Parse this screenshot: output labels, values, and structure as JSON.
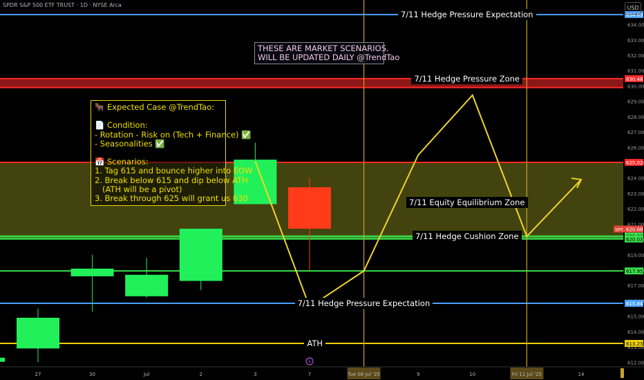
{
  "title": "SPDR S&P 500 ETF TRUST · 1D · NYSE Arca",
  "currency": "USD",
  "colors": {
    "bull": "#22f05a",
    "bear": "#ff3b1a",
    "scenario": "#f0d62a",
    "blue": "#4aa3ff",
    "red": "#ff2a2a",
    "green": "#39e04c",
    "yellow": "#f0d000"
  },
  "annotations": {
    "banner": "THESE ARE MARKET SCENARIOS.\nWILL BE UPDATED DAILY @TrendTao",
    "expected_case": "🐂 Expected Case @TrendTao:\n\n📄 Condition:\n- Rotation - Risk on (Tech + Finance) ✅\n- Seasonalities ✅\n\n📅 Scenarios:\n1. Tag 615 and bounce higher into EOW\n2. Break below 615 and dip below ATH\n   (ATH will be a pivot)\n3. Break through 625 will grant us 630"
  },
  "chart_data": {
    "type": "candlestick",
    "symbol": "SPY",
    "ylim": [
      611.7,
      635.6
    ],
    "yticks": [
      612,
      613,
      614,
      615,
      616,
      617,
      618,
      619,
      620,
      621,
      622,
      623,
      624,
      625,
      626,
      627,
      628,
      629,
      630,
      631,
      632,
      633,
      634
    ],
    "x_labels": [
      {
        "i": 0,
        "text": "27"
      },
      {
        "i": 1,
        "text": "30"
      },
      {
        "i": 2,
        "text": "Jul"
      },
      {
        "i": 3,
        "text": "2"
      },
      {
        "i": 4,
        "text": "3"
      },
      {
        "i": 5,
        "text": "7"
      },
      {
        "i": 6,
        "text": "Tue 08 Jul '25"
      },
      {
        "i": 7,
        "text": "9"
      },
      {
        "i": 8,
        "text": "10"
      },
      {
        "i": 9,
        "text": "Fri 11 Jul '25"
      },
      {
        "i": 10,
        "text": "14"
      }
    ],
    "candles": [
      {
        "i": 0,
        "open": 612.9,
        "high": 615.5,
        "low": 612.0,
        "close": 614.9
      },
      {
        "i": 1,
        "open": 617.6,
        "high": 619.0,
        "low": 615.3,
        "close": 618.1
      },
      {
        "i": 2,
        "open": 616.3,
        "high": 618.8,
        "low": 616.2,
        "close": 617.7
      },
      {
        "i": 3,
        "open": 617.3,
        "high": 620.7,
        "low": 616.7,
        "close": 620.7
      },
      {
        "i": 4,
        "open": 622.3,
        "high": 626.3,
        "low": 622.3,
        "close": 625.2
      },
      {
        "i": 5,
        "open": 623.4,
        "high": 624.0,
        "low": 618.0,
        "close": 620.7
      }
    ],
    "levels": [
      {
        "name": "7/11 Hedge Pressure Expectation",
        "price": 634.65,
        "color": "blue",
        "badge": "634.65",
        "label_i": 7.9
      },
      {
        "name": "7/11 Hedge Pressure Zone",
        "price": 630.48,
        "price2": 629.9,
        "color": "red",
        "badge": "630.48",
        "label_i": 7.9
      },
      {
        "name": "",
        "price": 625.02,
        "color": "red",
        "badge": "625.02"
      },
      {
        "name": "7/11 Equity Equilibrium Zone",
        "price": 622.4,
        "color": "none",
        "label_i": 7.9
      },
      {
        "name": "7/11 Hedge Cushion Zone",
        "price": 620.22,
        "price2": 620.03,
        "color": "green",
        "badge": "620.22",
        "badge2": "620.03",
        "label_i": 7.9
      },
      {
        "name": "",
        "price": 617.95,
        "color": "green",
        "badge": "617.95"
      },
      {
        "name": "7/11 Hedge Pressure Expectation",
        "price": 615.84,
        "color": "blue",
        "badge": "615.84",
        "label_i": 6.0
      },
      {
        "name": "ATH",
        "price": 613.23,
        "color": "yellow",
        "badge": "613.23",
        "label_i": 5.1
      }
    ],
    "zone": {
      "from": 620.1,
      "to": 625.02
    },
    "last_price": {
      "symbol": "SPY",
      "price": "620.68"
    },
    "scenario_path": [
      {
        "i": 4.0,
        "v": 625.1
      },
      {
        "i": 5.0,
        "v": 615.6
      },
      {
        "i": 6.0,
        "v": 617.95
      },
      {
        "i": 7.0,
        "v": 625.5
      },
      {
        "i": 8.0,
        "v": 629.4
      },
      {
        "i": 9.0,
        "v": 620.2
      },
      {
        "i": 10.0,
        "v": 623.9
      }
    ],
    "vlines": [
      6,
      9
    ]
  }
}
